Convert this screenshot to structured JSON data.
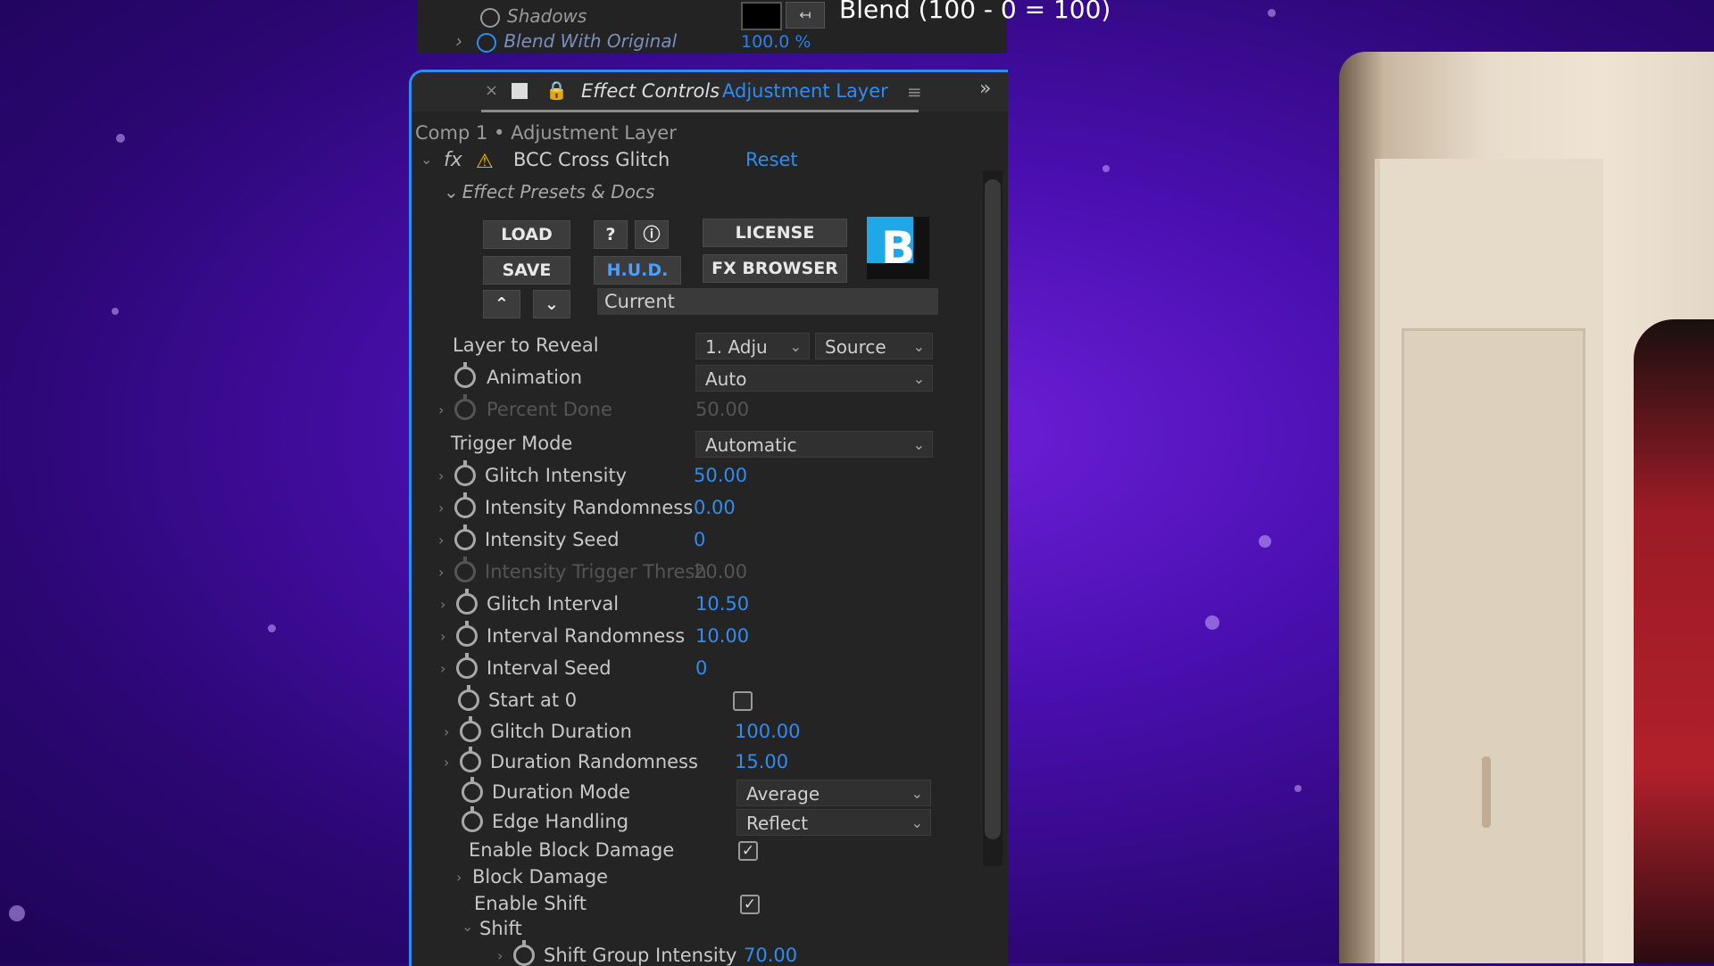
{
  "top_strip": {
    "shadows_label": "Shadows",
    "blend_label": "Blend With Original",
    "blend_value": "100.0 %",
    "blend_formula": "Blend (100 - 0 = 100)"
  },
  "panel": {
    "tab": {
      "close": "×",
      "lock": "🔒",
      "title": "Effect Controls",
      "layer_name": "Adjustment Layer",
      "menu": "≡",
      "more": "»"
    },
    "breadcrumb": "Comp 1 • Adjustment Layer",
    "effect": {
      "fx": "fx",
      "warning": "⚠",
      "name": "BCC Cross Glitch",
      "reset": "Reset"
    },
    "presets_section": "Effect Presets & Docs",
    "buttons": {
      "load": "LOAD",
      "help": "?",
      "info": "ⓘ",
      "license": "LICENSE",
      "save": "SAVE",
      "hud": "H.U.D.",
      "fx_browser": "FX BROWSER",
      "up": "⌃",
      "down": "⌄",
      "current": "Current",
      "logo": "B"
    },
    "params": {
      "layer_to_reveal": {
        "label": "Layer to Reveal",
        "value1": "1. Adju",
        "value2": "Source"
      },
      "animation": {
        "label": "Animation",
        "value": "Auto"
      },
      "percent_done": {
        "label": "Percent Done",
        "value": "50.00"
      },
      "trigger_mode": {
        "label": "Trigger Mode",
        "value": "Automatic"
      },
      "glitch_intensity": {
        "label": "Glitch Intensity",
        "value": "50.00"
      },
      "intensity_randomness": {
        "label": "Intensity Randomness",
        "value": "0.00"
      },
      "intensity_seed": {
        "label": "Intensity Seed",
        "value": "0"
      },
      "intensity_trigger_thresh": {
        "label": "Intensity Trigger Thresh",
        "value": "20.00"
      },
      "glitch_interval": {
        "label": "Glitch Interval",
        "value": "10.50"
      },
      "interval_randomness": {
        "label": "Interval Randomness",
        "value": "10.00"
      },
      "interval_seed": {
        "label": "Interval Seed",
        "value": "0"
      },
      "start_at_0": {
        "label": "Start at 0",
        "checked": false
      },
      "glitch_duration": {
        "label": "Glitch Duration",
        "value": "100.00"
      },
      "duration_randomness": {
        "label": "Duration Randomness",
        "value": "15.00"
      },
      "duration_mode": {
        "label": "Duration Mode",
        "value": "Average"
      },
      "edge_handling": {
        "label": "Edge Handling",
        "value": "Reflect"
      },
      "enable_block_damage": {
        "label": "Enable Block Damage",
        "checked": true
      },
      "block_damage": {
        "label": "Block Damage"
      },
      "enable_shift": {
        "label": "Enable Shift",
        "checked": true
      },
      "shift": {
        "label": "Shift"
      },
      "shift_group_intensity": {
        "label": "Shift Group Intensity",
        "value": "70.00"
      }
    }
  },
  "icons": {
    "stopwatch": "stopwatch-icon",
    "twirl": "›",
    "twirl_open": "⌄",
    "check": "✓",
    "dropdown": "⌄"
  },
  "colors": {
    "accent_blue": "#2f8cf0",
    "panel_bg": "#242424",
    "background_purple": "#4a0fb0"
  }
}
